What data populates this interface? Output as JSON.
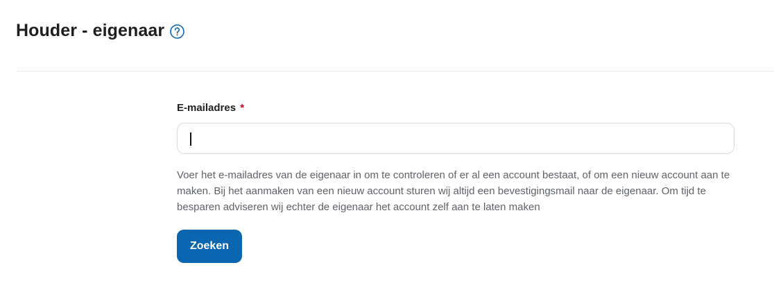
{
  "header": {
    "title": "Houder - eigenaar",
    "help_icon": "question-circle-icon"
  },
  "form": {
    "email": {
      "label": "E-mailadres",
      "required_marker": "*",
      "value": "",
      "placeholder": ""
    },
    "help_text": "Voer het e-mailadres van de eigenaar in om te controleren of er al een account bestaat, of om een nieuw account aan te maken. Bij het aanmaken van een nieuw account sturen wij altijd een bevestigingsmail naar de eigenaar. Om tijd te besparen adviseren wij echter de eigenaar het account zelf aan te laten maken",
    "submit_label": "Zoeken"
  },
  "colors": {
    "accent": "#0a66b0",
    "required": "#d0021b",
    "muted_text": "#5f6368",
    "border": "#d5d8dc"
  }
}
